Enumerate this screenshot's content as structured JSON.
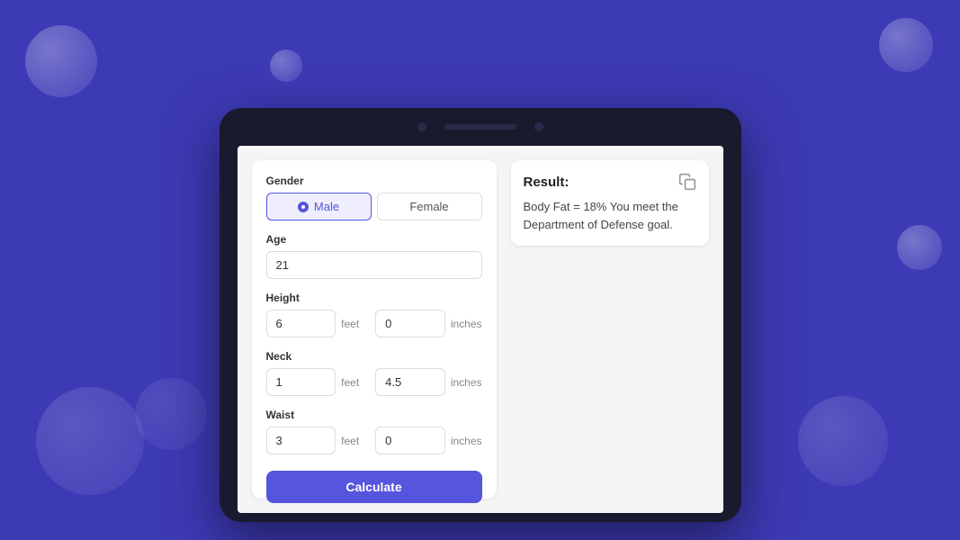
{
  "background": {
    "color": "#3d3ab5"
  },
  "form": {
    "gender_label": "Gender",
    "male_label": "Male",
    "female_label": "Female",
    "age_label": "Age",
    "age_value": "21",
    "height_label": "Height",
    "height_feet_value": "6",
    "height_inches_value": "0",
    "neck_label": "Neck",
    "neck_feet_value": "1",
    "neck_inches_value": "4.5",
    "waist_label": "Waist",
    "waist_feet_value": "3",
    "waist_inches_value": "0",
    "feet_unit": "feet",
    "inches_unit": "inches",
    "calculate_label": "Calculate"
  },
  "result": {
    "title": "Result:",
    "text": "Body Fat = 18% You meet the Department of Defense goal."
  }
}
